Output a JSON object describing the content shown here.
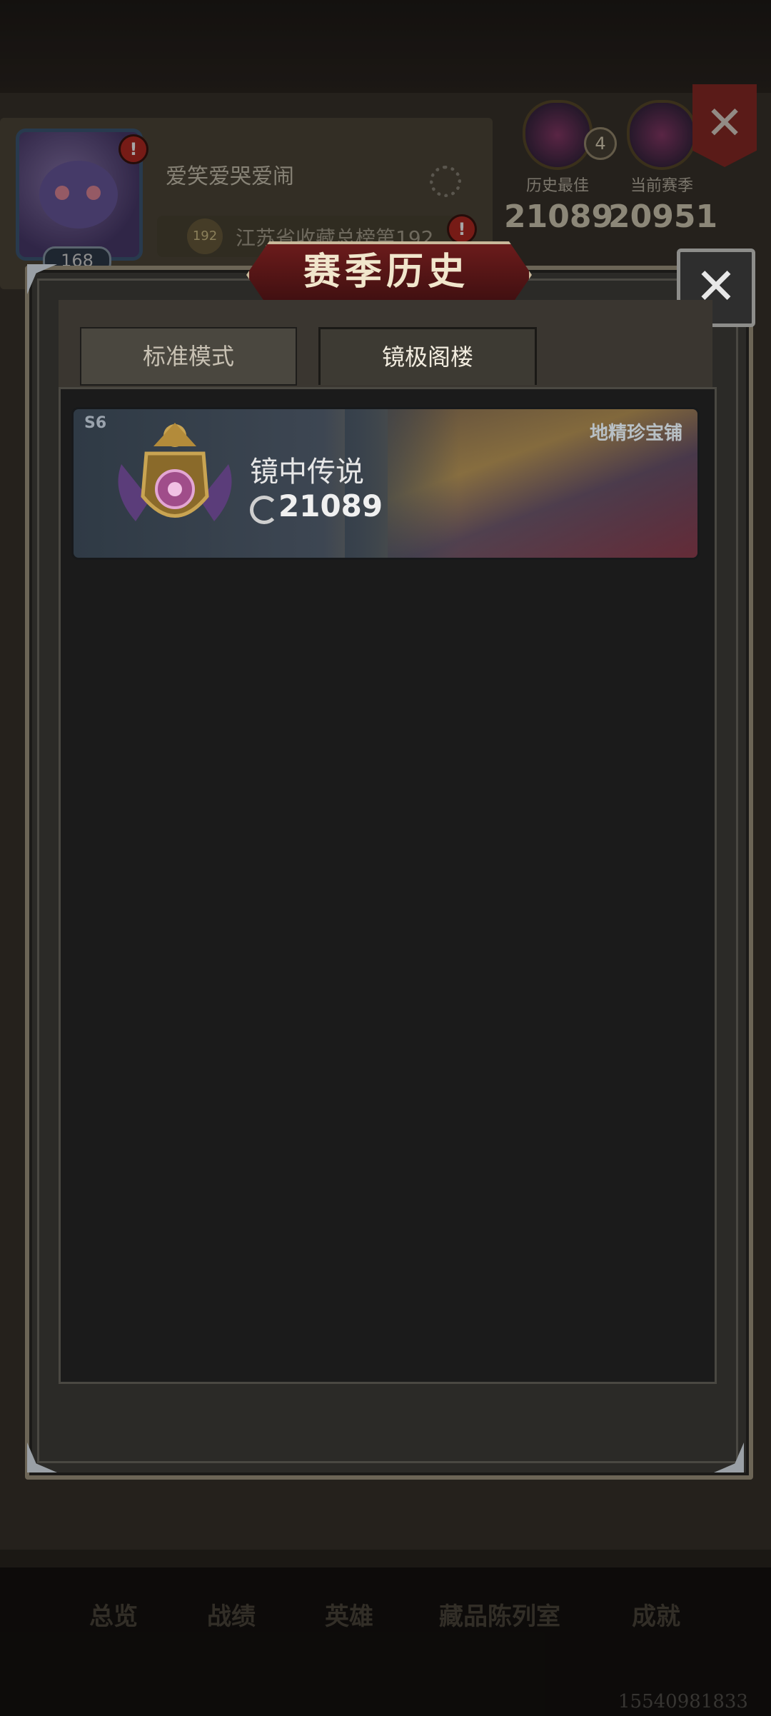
{
  "background": {
    "username": "爱笑爱哭爱闹",
    "level": "168",
    "rank_medal": "192",
    "rank_text": "江苏省收藏总榜第192",
    "stats": [
      {
        "label": "历史最佳",
        "value": "21089"
      },
      {
        "label": "当前赛季",
        "value": "20951"
      }
    ],
    "stat_badge": "4",
    "close_glyph": "✕",
    "nav": [
      "总览",
      "战绩",
      "英雄",
      "藏品陈列室",
      "成就"
    ],
    "watermark": "15540981833"
  },
  "modal": {
    "title": "赛季历史",
    "close_glyph": "✕",
    "tabs": [
      {
        "label": "标准模式",
        "active": false
      },
      {
        "label": "镜极阁楼",
        "active": true
      }
    ],
    "seasons": [
      {
        "season": "S6",
        "rank_name": "镜中传说",
        "score": "21089",
        "shop": "地精珍宝铺"
      }
    ]
  },
  "icons": {
    "settings": "gear-icon",
    "score": "swirl-icon",
    "close": "close-icon"
  },
  "colors": {
    "title_red": "#6b1b1b",
    "alert_red": "#b52a22",
    "panel_dark": "#1b1b1b"
  }
}
